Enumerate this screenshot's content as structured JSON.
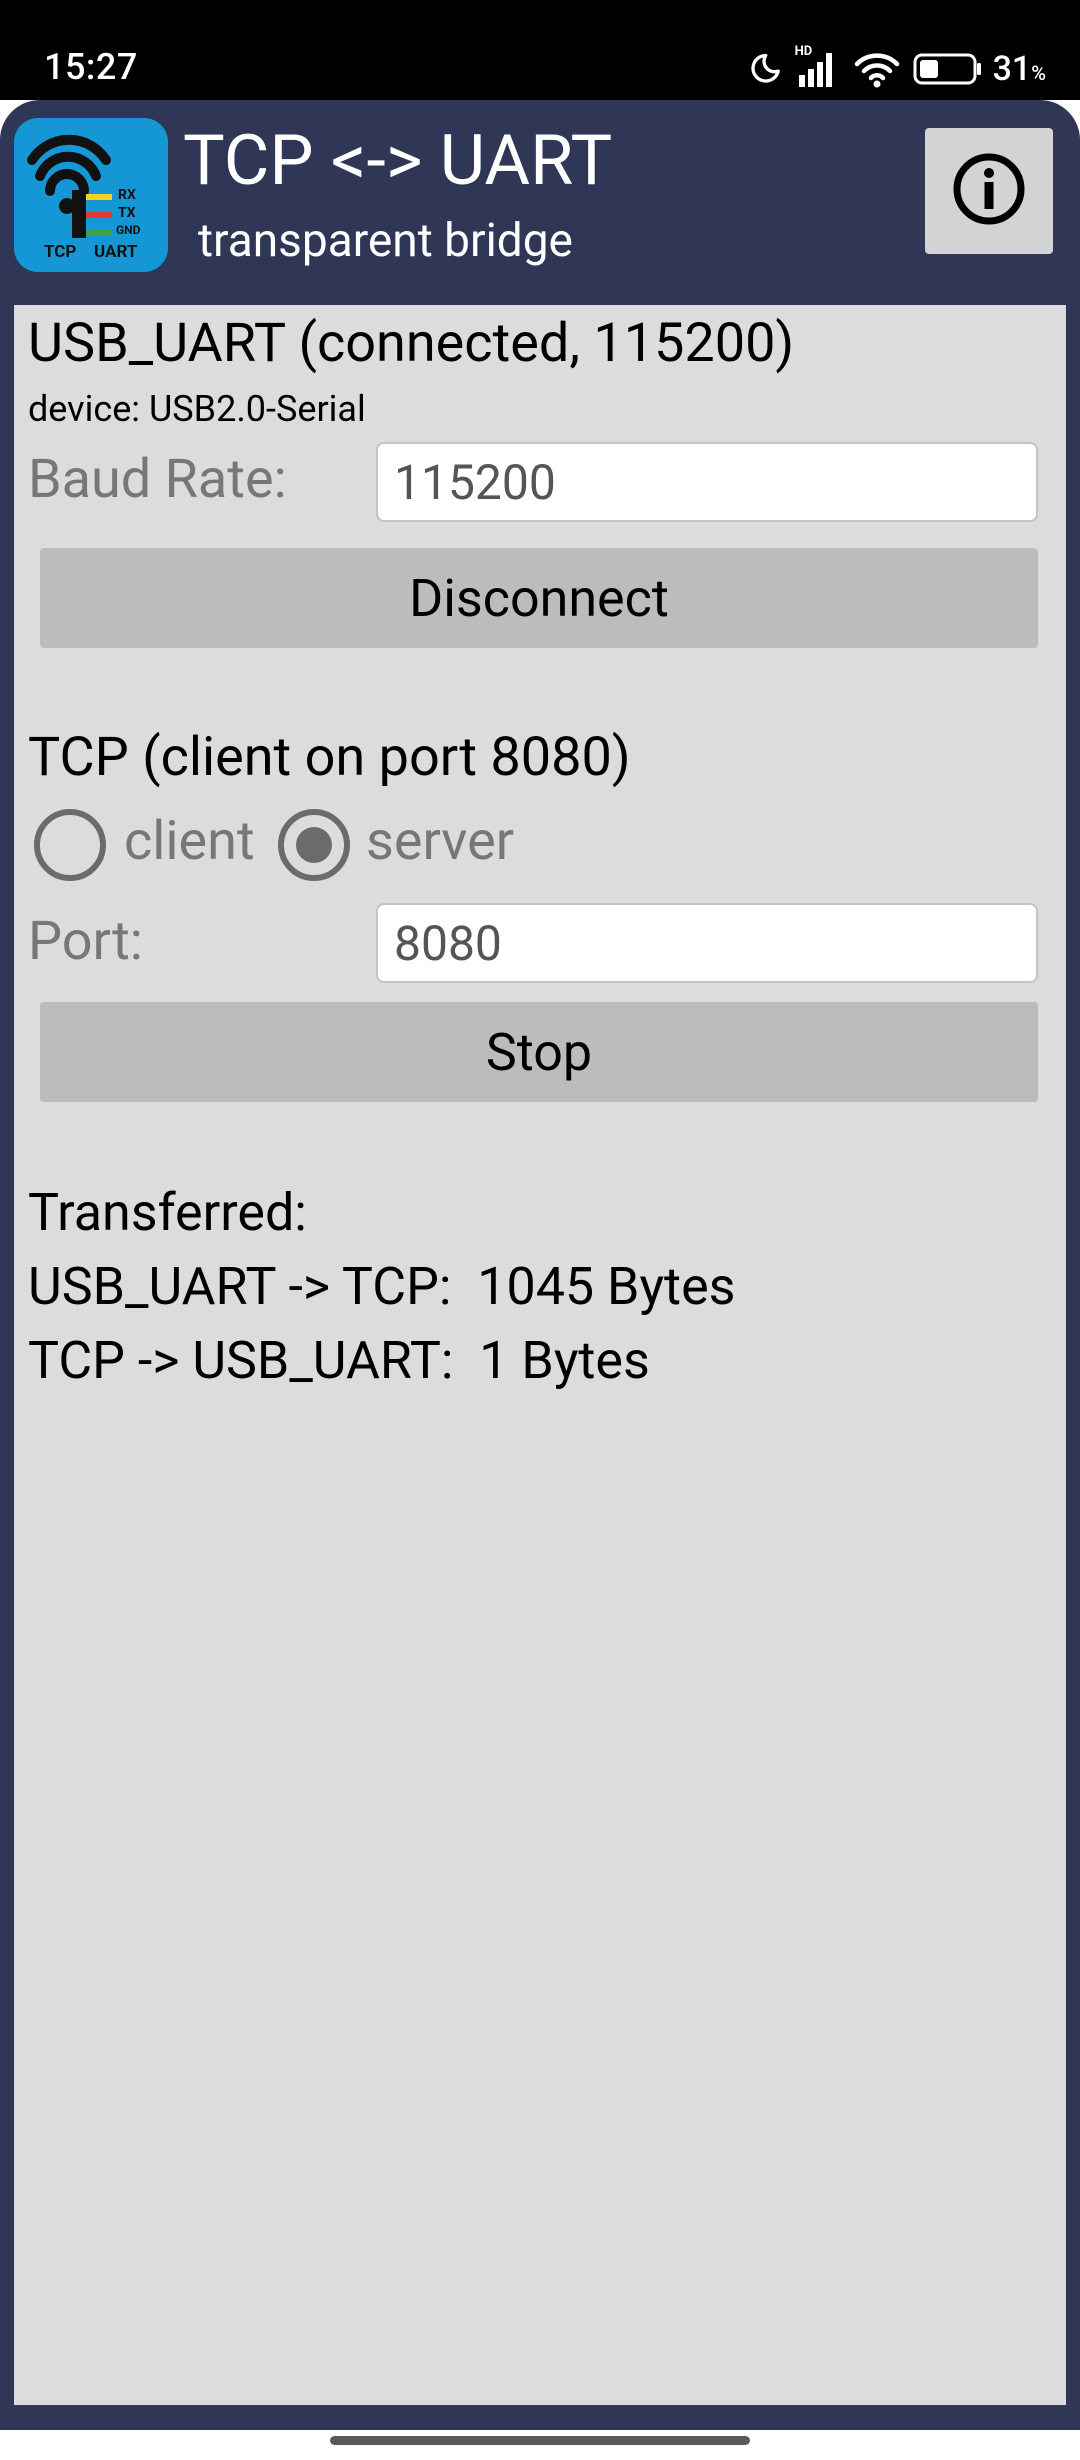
{
  "status_bar": {
    "time": "15:27",
    "network_badge": "HD",
    "battery_percent": "31",
    "battery_unit": "%",
    "icons": [
      "moon-icon",
      "signal-icon",
      "wifi-icon",
      "battery-icon"
    ]
  },
  "header": {
    "title": "TCP <-> UART",
    "subtitle": "transparent bridge",
    "info_icon": "info-circle-icon",
    "logo": {
      "pins": [
        "RX",
        "TX",
        "GND"
      ],
      "label_left": "TCP",
      "label_right": "UART",
      "colors": {
        "background": "#1597d5",
        "rx": "#f6d21d",
        "tx": "#e53935",
        "gnd": "#43a047"
      }
    }
  },
  "uart": {
    "section_title": "USB_UART (connected, 115200)",
    "device_line": "device: USB2.0-Serial",
    "baud_label": "Baud Rate:",
    "baud_value": "115200",
    "disconnect_label": "Disconnect"
  },
  "tcp": {
    "section_title": "TCP (client on port 8080)",
    "mode_options": [
      {
        "label": "client",
        "selected": false
      },
      {
        "label": "server",
        "selected": true
      }
    ],
    "port_label": "Port:",
    "port_value": "8080",
    "stop_label": "Stop"
  },
  "stats": {
    "heading": "Transferred:",
    "uart_to_tcp": "USB_UART -> TCP:  1045 Bytes",
    "tcp_to_uart": "TCP -> USB_UART:  1 Bytes"
  },
  "colors": {
    "app_frame": "#2f3656",
    "content_background": "#dcdcdc",
    "button_background": "#bcbcbc",
    "info_button_background": "#d3d3d3"
  }
}
